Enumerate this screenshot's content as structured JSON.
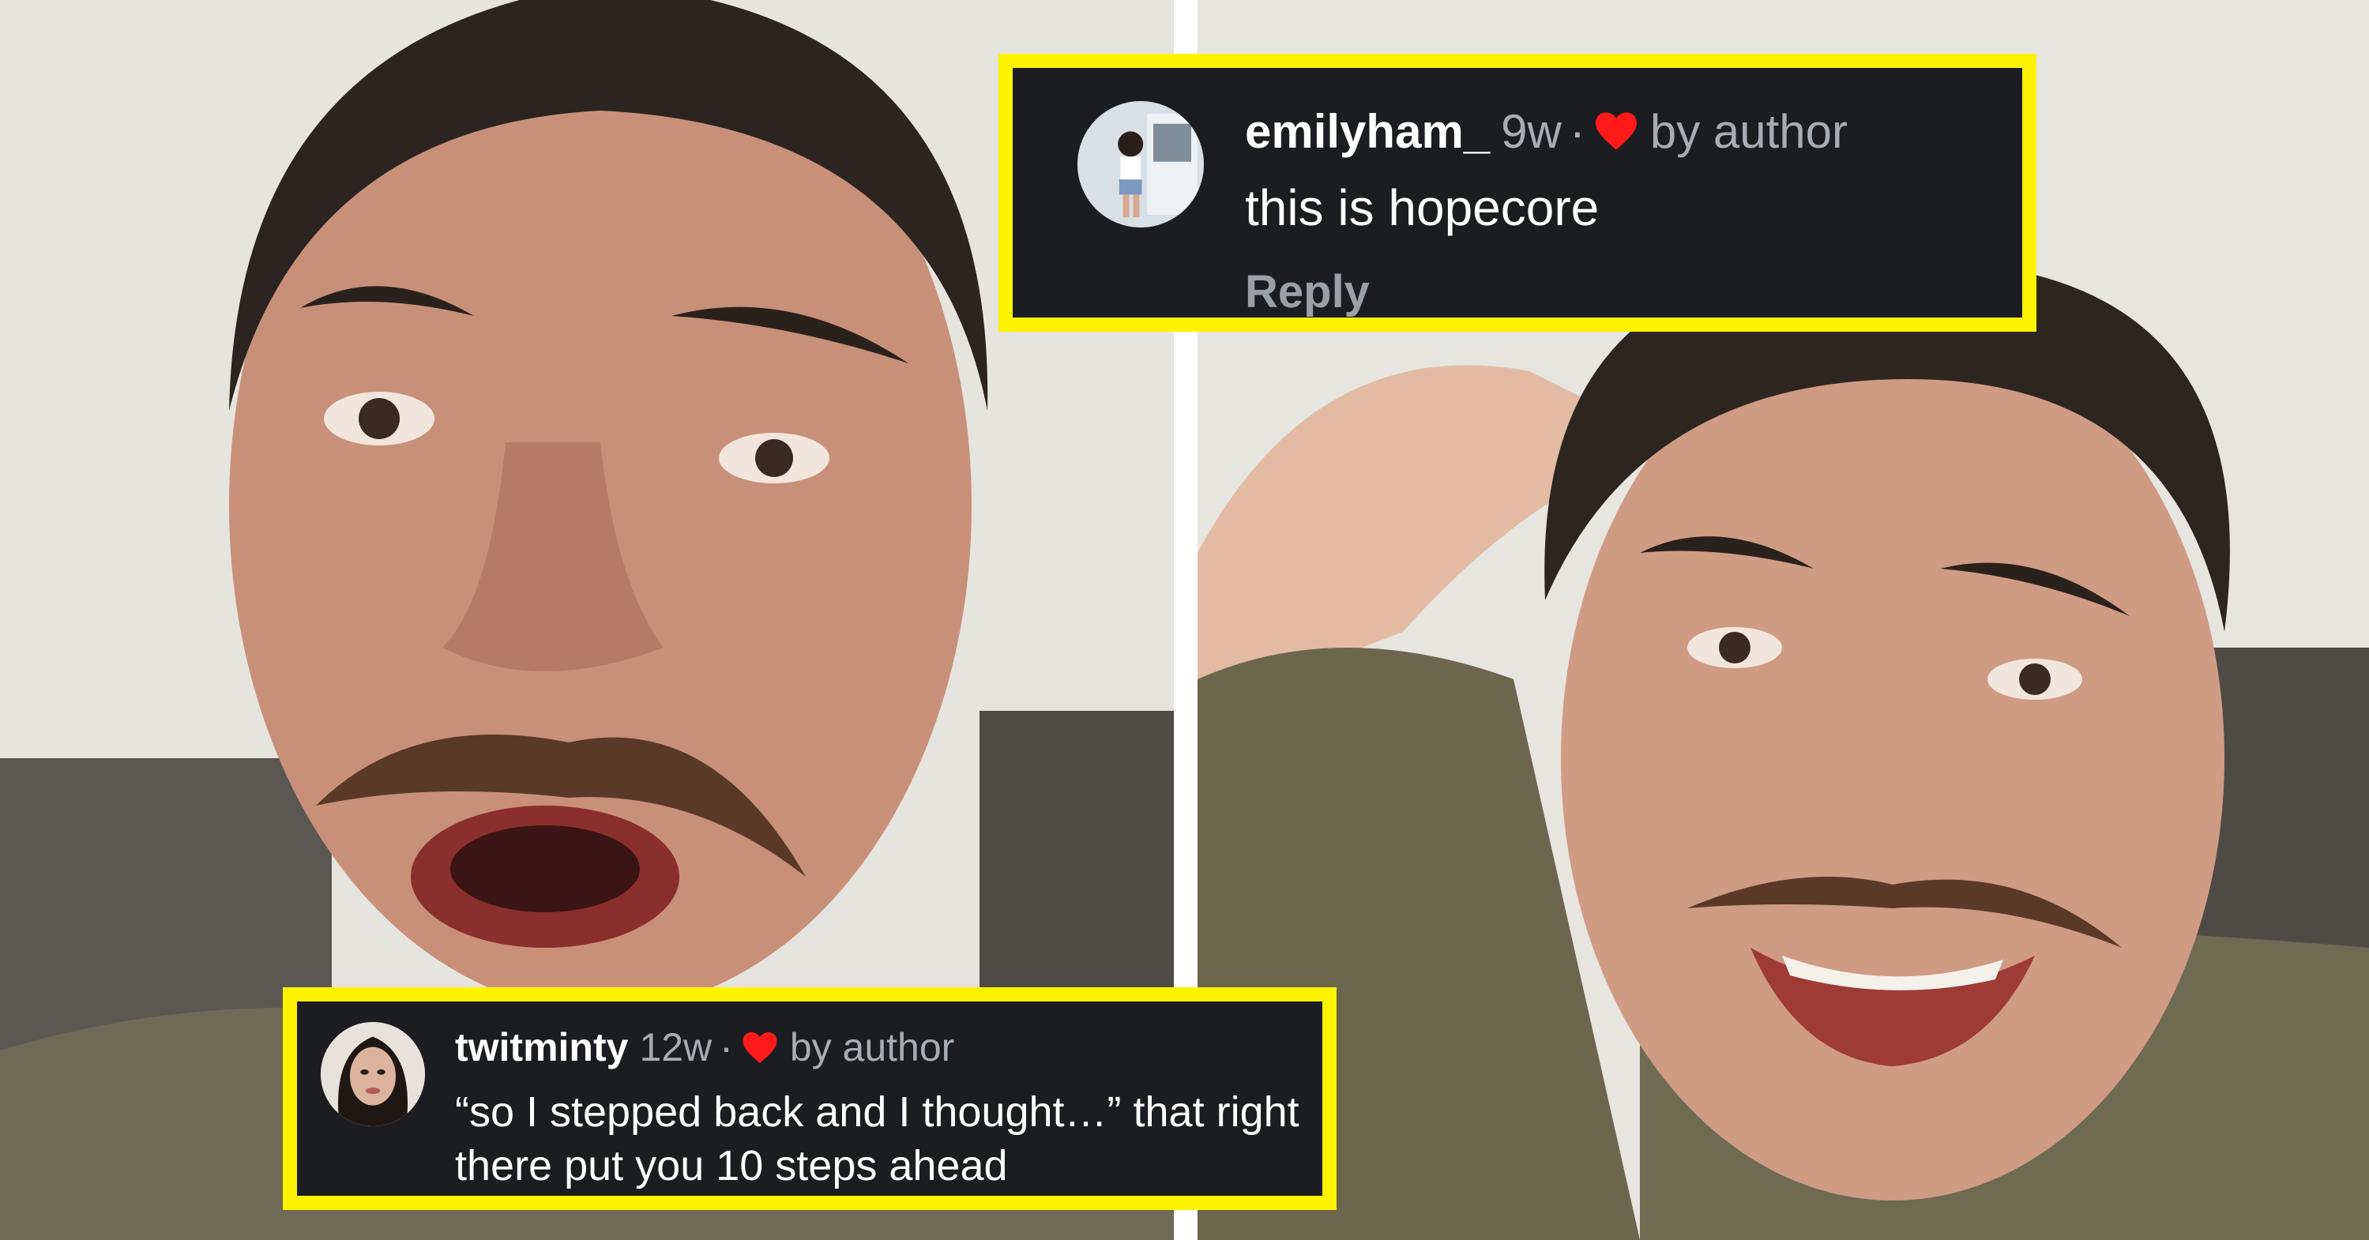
{
  "comments": [
    {
      "username": "emilyham_",
      "age": "9w",
      "separator": "·",
      "by_author_label": "by author",
      "text": "this is hopecore",
      "reply_label": "Reply",
      "icon": "heart-icon",
      "heart_color": "#ff1a1a"
    },
    {
      "username": "twitminty",
      "age": "12w",
      "separator": "·",
      "by_author_label": "by author",
      "text": "“so I stepped back and I thought…” that right there put you 10 steps ahead",
      "icon": "heart-icon",
      "heart_color": "#ff1a1a"
    }
  ],
  "colors": {
    "highlight_border": "#fff200",
    "card_background": "#1b1d21",
    "muted_text": "#a8adb3"
  }
}
